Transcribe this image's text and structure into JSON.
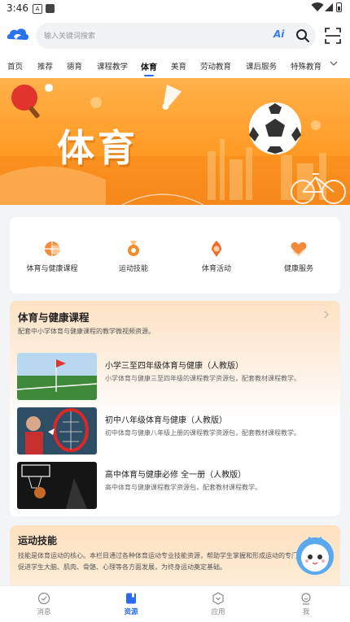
{
  "status_bar": {
    "time": "3:46",
    "notification_icon": "A"
  },
  "header": {
    "logo_icon": "cloud-bird-logo-icon",
    "search_placeholder": "输入关键词搜索",
    "ai_label": "Ai",
    "scan_icon": "scan-icon"
  },
  "tabs": [
    {
      "label": "首页"
    },
    {
      "label": "推荐"
    },
    {
      "label": "德育"
    },
    {
      "label": "课程教学"
    },
    {
      "label": "体育",
      "active": true
    },
    {
      "label": "美育"
    },
    {
      "label": "劳动教育"
    },
    {
      "label": "课后服务"
    },
    {
      "label": "特殊教育"
    }
  ],
  "banner": {
    "title": "体育"
  },
  "quick_links": [
    {
      "label": "体育与健康课程",
      "icon": "basketball-icon",
      "color": "#f5823a"
    },
    {
      "label": "运动技能",
      "icon": "medal-icon",
      "color": "#f58a2a"
    },
    {
      "label": "体育活动",
      "icon": "award-ribbon-icon",
      "color": "#f26b2c"
    },
    {
      "label": "健康服务",
      "icon": "heart-hands-icon",
      "color": "#f5823a"
    }
  ],
  "courses": {
    "title": "体育与健康课程",
    "subtitle": "配套中小学体育与健康课程的教学微视频资源。",
    "items": [
      {
        "title": "小学三至四年级体育与健康（人教版）",
        "desc": "小学体育与健康三至四年级的课程教学资源包，配套教材课程教学。"
      },
      {
        "title": "初中八年级体育与健康（人教版）",
        "desc": "初中体育与健康八年级上册的课程教学资源包，配套教材课程教学。"
      },
      {
        "title": "高中体育与健康必修 全一册（人教版）",
        "desc": "高中体育与健康课程教学资源包，配套教材课程教学。"
      }
    ]
  },
  "skills": {
    "title": "运动技能",
    "desc": "技能是体育运动的核心。本栏目通过各种体育运动专业技能资源，帮助学生掌握和形成运动的专门动作能力，促进学生大脑、肌肉、骨骼、心理等各方面发展，为终身运动奠定基础。"
  },
  "bottom_nav": [
    {
      "label": "消息",
      "icon": "message-check-icon"
    },
    {
      "label": "资源",
      "icon": "book-resource-icon",
      "active": true
    },
    {
      "label": "应用",
      "icon": "app-hex-icon"
    },
    {
      "label": "我",
      "icon": "profile-icon"
    }
  ],
  "colors": {
    "accent": "#2a6cf0",
    "banner_orange": "#ff9a24"
  }
}
